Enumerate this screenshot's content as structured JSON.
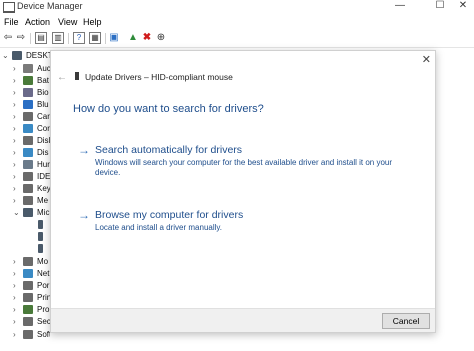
{
  "window": {
    "title": "Device Manager",
    "minimize": "—",
    "maximize": "☐",
    "close": "✕"
  },
  "menu": [
    "File",
    "Action",
    "View",
    "Help"
  ],
  "tree": {
    "root": "DESKTO",
    "items": [
      {
        "label": "Auc",
        "color": "#7a7a7a"
      },
      {
        "label": "Bat",
        "color": "#4a7a3a"
      },
      {
        "label": "Bio",
        "color": "#6a6a8a"
      },
      {
        "label": "Blu",
        "color": "#2b6fc4"
      },
      {
        "label": "Car",
        "color": "#6a6a6a"
      },
      {
        "label": "Cor",
        "color": "#3a8ac4"
      },
      {
        "label": "Disl",
        "color": "#6a6a6a"
      },
      {
        "label": "Dis",
        "color": "#3a8ac4"
      },
      {
        "label": "Hur",
        "color": "#6a7a8a"
      },
      {
        "label": "IDE",
        "color": "#6a6a6a"
      },
      {
        "label": "Key",
        "color": "#6a6a6a"
      },
      {
        "label": "Me",
        "color": "#6a6a6a"
      },
      {
        "label": "Mic",
        "color": "#4a5a6a"
      }
    ],
    "bottom_items": [
      {
        "label": "Mo",
        "color": "#6a6a6a"
      },
      {
        "label": "Net",
        "color": "#3a8ac4"
      },
      {
        "label": "Por",
        "color": "#6a6a6a"
      },
      {
        "label": "Prin",
        "color": "#6a6a6a"
      },
      {
        "label": "Pro",
        "color": "#4a7a3a"
      },
      {
        "label": "Sec",
        "color": "#6a6a6a"
      },
      {
        "label": "Software devices",
        "color": "#6a6a6a"
      }
    ]
  },
  "dialog": {
    "close": "✕",
    "back": "←",
    "header_title": "Update Drivers – HID-compliant mouse",
    "question": "How do you want to search for drivers?",
    "options": [
      {
        "arrow": "→",
        "title": "Search automatically for drivers",
        "desc": "Windows will search your computer for the best available driver and install it on your device."
      },
      {
        "arrow": "→",
        "title": "Browse my computer for drivers",
        "desc": "Locate and install a driver manually."
      }
    ],
    "cancel": "Cancel"
  }
}
